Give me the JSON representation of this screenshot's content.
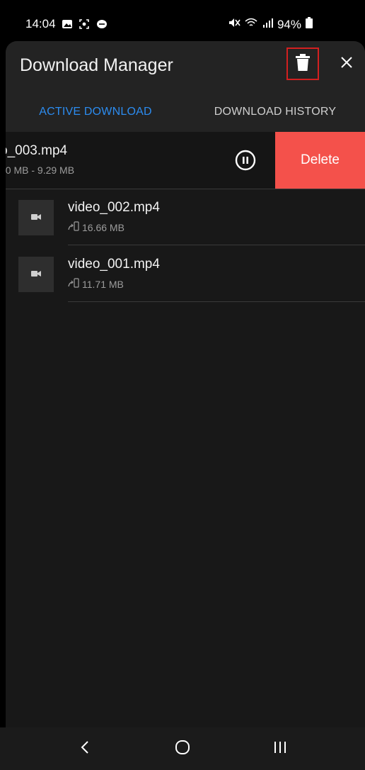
{
  "status_bar": {
    "time": "14:04",
    "battery": "94%",
    "icons": [
      "gallery-icon",
      "screenshot-icon",
      "chat-icon",
      "mute-icon",
      "wifi-icon",
      "signal-icon",
      "battery-icon"
    ]
  },
  "header": {
    "title": "Download Manager",
    "delete_all_icon": "trash-icon",
    "close_icon": "close-icon"
  },
  "tabs": [
    {
      "label": "ACTIVE DOWNLOAD",
      "active": true
    },
    {
      "label": "DOWNLOAD HISTORY",
      "active": false
    }
  ],
  "colors": {
    "accent": "#2c8cf0",
    "delete": "#f4514b",
    "highlight_border": "#d32020"
  },
  "downloads": [
    {
      "name": "o_003.mp4",
      "size": "00 MB - 9.29 MB",
      "swiped": true,
      "action": "Delete",
      "control": "pause-icon"
    },
    {
      "name": "video_002.mp4",
      "size": "16.66 MB",
      "swiped": false,
      "icon": "video-icon"
    },
    {
      "name": "video_001.mp4",
      "size": "11.71 MB",
      "swiped": false,
      "icon": "video-icon"
    }
  ],
  "nav": [
    "back-icon",
    "home-icon",
    "recents-icon"
  ]
}
